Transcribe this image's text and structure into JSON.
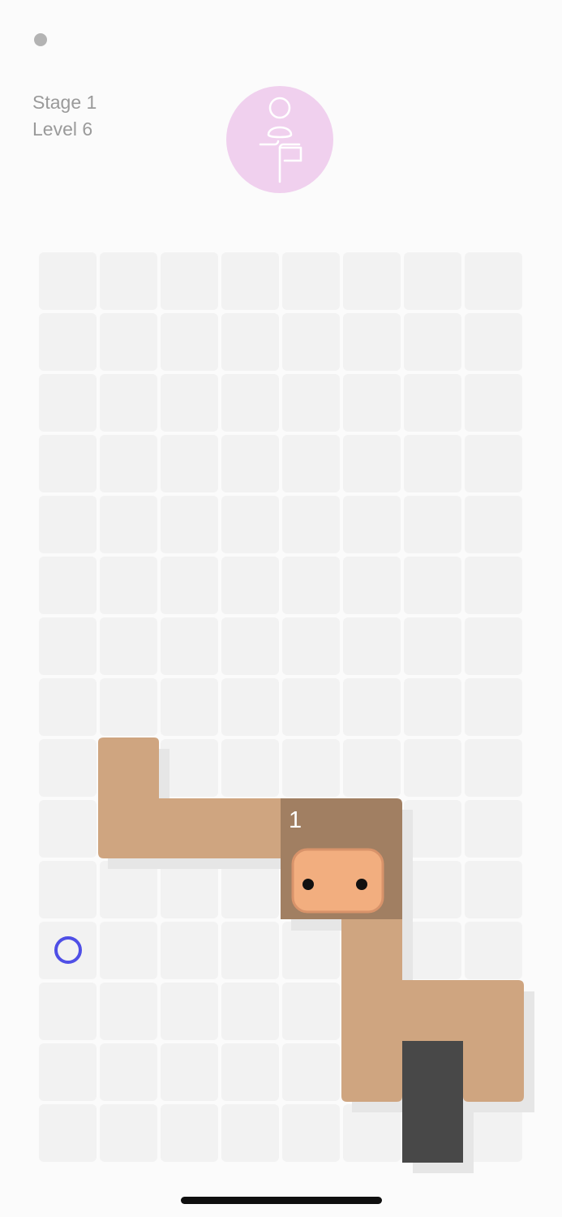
{
  "header": {
    "menu_icon": "menu-dot-icon",
    "stage_label": "Stage 1",
    "level_label": "Level 6",
    "pose_icon": "yoga-tree-pose-icon"
  },
  "board": {
    "columns": 8,
    "rows": 15,
    "goal_marker": {
      "col": 0,
      "row": 11,
      "color": "#4f4fe6"
    },
    "head_badge_number": "1"
  },
  "colors": {
    "background": "#fbfbfb",
    "cell": "#f2f2f2",
    "body_segment": "#cfa580",
    "head_block": "#a17f62",
    "face": "#f2ae7f",
    "face_border": "#d8936a",
    "dark_block": "#484848",
    "shadow": "#e6e6e6",
    "pose_circle": "#f0d0ee",
    "goal_marker": "#4f4fe6"
  }
}
